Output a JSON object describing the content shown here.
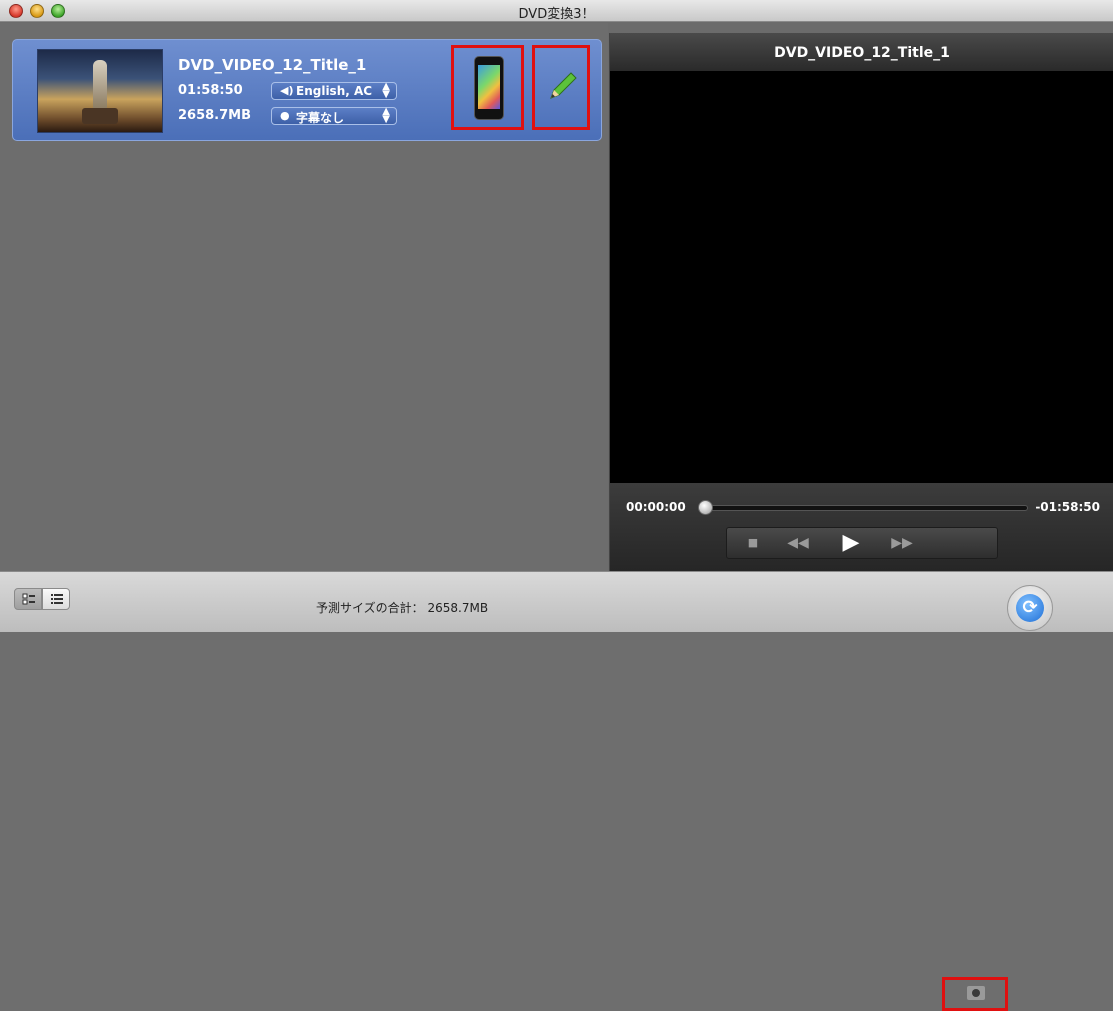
{
  "window": {
    "title": "DVD変換3！"
  },
  "item": {
    "title": "DVD_VIDEO_12_Title_1",
    "duration": "01:58:50",
    "size": "2658.7MB",
    "audio_label": "English, AC",
    "subtitle_label": "字幕なし"
  },
  "player": {
    "title": "DVD_VIDEO_12_Title_1",
    "time_current": "00:00:00",
    "time_remaining": "-01:58:50",
    "progress": 0
  },
  "footer": {
    "total_label": "予測サイズの合計：",
    "total_value": "2658.7MB"
  },
  "colors": {
    "selection": "#5a7ec6",
    "highlight_border": "#e01010"
  }
}
